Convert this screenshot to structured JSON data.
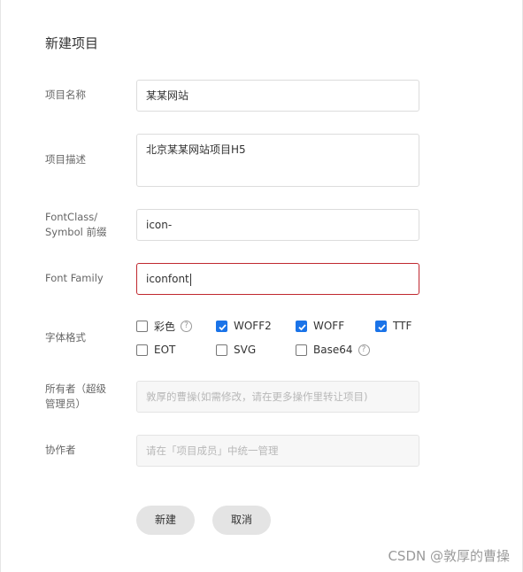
{
  "dialog": {
    "title": "新建项目"
  },
  "form": {
    "name": {
      "label": "项目名称",
      "value": "某某网站"
    },
    "description": {
      "label": "项目描述",
      "value": "北京某某网站项目H5"
    },
    "prefix": {
      "label_line1": "FontClass/",
      "label_line2": "Symbol 前缀",
      "value": "icon-"
    },
    "font_family": {
      "label": "Font Family",
      "value": "iconfont"
    },
    "formats": {
      "label": "字体格式",
      "options": [
        {
          "label": "彩色",
          "checked": false,
          "help": true
        },
        {
          "label": "WOFF2",
          "checked": true
        },
        {
          "label": "WOFF",
          "checked": true
        },
        {
          "label": "TTF",
          "checked": true
        },
        {
          "label": "EOT",
          "checked": false
        },
        {
          "label": "SVG",
          "checked": false
        },
        {
          "label": "Base64",
          "checked": false,
          "help": true
        }
      ]
    },
    "owner": {
      "label_line1": "所有者（超级",
      "label_line2": "管理员）",
      "placeholder": "敦厚的曹操(如需修改，请在更多操作里转让项目)"
    },
    "collaborators": {
      "label": "协作者",
      "placeholder": "请在「项目成员」中统一管理"
    }
  },
  "buttons": {
    "create": "新建",
    "cancel": "取消"
  },
  "watermark": "CSDN @敦厚的曹操",
  "colors": {
    "checkbox": "#1a73e8",
    "focus_border": "#c0282f"
  }
}
